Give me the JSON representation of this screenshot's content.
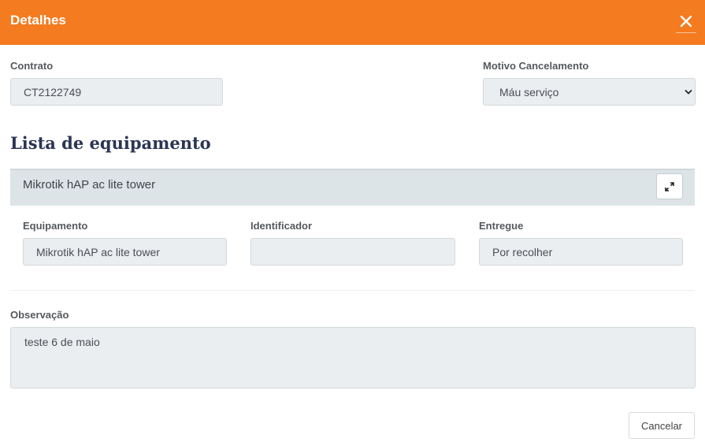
{
  "modal": {
    "title": "Detalhes",
    "close_icon": "close-icon",
    "header_color": "#f47b20"
  },
  "contract": {
    "label": "Contrato",
    "value": "CT2122749"
  },
  "cancel_reason": {
    "label": "Motivo Cancelamento",
    "selected": "Máu serviço"
  },
  "equipment_section": {
    "title": "Lista de equipamento",
    "item": {
      "header": "Mikrotik hAP ac lite tower",
      "expand_icon": "expand-icon",
      "fields": {
        "equipment_label": "Equipamento",
        "equipment_value": "Mikrotik hAP ac lite tower",
        "identifier_label": "Identificador",
        "identifier_value": "",
        "delivered_label": "Entregue",
        "delivered_value": "Por recolher"
      }
    }
  },
  "observation": {
    "label": "Observação",
    "value": "teste 6 de maio"
  },
  "footer": {
    "cancel_label": "Cancelar"
  }
}
